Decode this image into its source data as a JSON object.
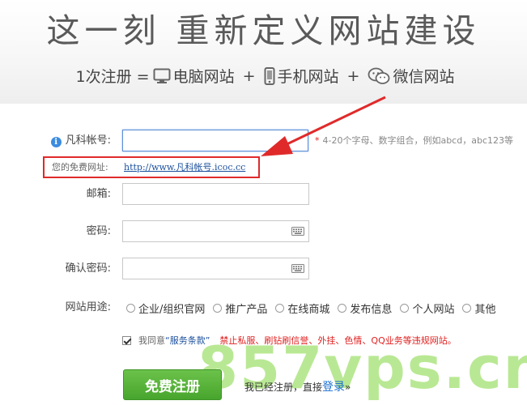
{
  "hero": {
    "title": "这一刻 重新定义网站建设",
    "subtitle": {
      "prefix": "1次注册 =",
      "items": [
        {
          "icon": "monitor-icon",
          "label": "电脑网站"
        },
        {
          "icon": "mobile-phone-icon",
          "label": "手机网站"
        },
        {
          "icon": "wechat-icon",
          "label": "微信网站"
        }
      ],
      "plus": "+"
    }
  },
  "form": {
    "account": {
      "label": "凡科帐号:",
      "value": "",
      "hint": "4-20个字母、数字组合，例如abcd，abc123等",
      "required_mark": "*"
    },
    "free_url": {
      "label": "您的免费网址:",
      "link": "http://www.凡科帐号.icoc.cc"
    },
    "email": {
      "label": "邮箱:",
      "value": ""
    },
    "password": {
      "label": "密码:",
      "value": ""
    },
    "confirm_password": {
      "label": "确认密码:",
      "value": ""
    },
    "purpose": {
      "label": "网站用途:",
      "options": [
        "企业/组织官网",
        "推广产品",
        "在线商城",
        "发布信息",
        "个人网站",
        "其他"
      ]
    },
    "agreement": {
      "prefix": "我同意",
      "terms": "“服务条款”",
      "warning": "禁止私服、刷钻刷信誉、外挂、色情、QQ业务等违规网站。",
      "checked": true
    },
    "register_label": "免费注册",
    "login_prefix": "我已经注册，直接",
    "login_link": "登录",
    "login_suffix": "»"
  },
  "watermark": "857vps.cn",
  "colors": {
    "register_button": "#47a52d",
    "warning": "#e02020",
    "highlight_box": "#e02a2a",
    "link": "#1a4f9c"
  }
}
